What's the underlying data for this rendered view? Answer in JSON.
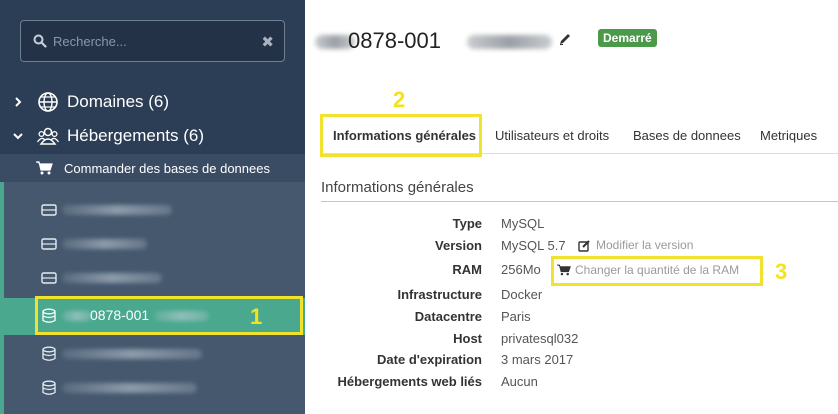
{
  "search": {
    "placeholder": "Recherche...",
    "clear_glyph": "✖"
  },
  "nav": {
    "domains": {
      "label": "Domaines (6)",
      "icon": "globe-icon"
    },
    "hosting": {
      "label": "Hébergements (6)",
      "icon": "users-icon"
    },
    "order": {
      "label": "Commander des bases de donnees",
      "icon": "cart-icon"
    }
  },
  "db_list": {
    "active_name": "0878-001"
  },
  "annotations": {
    "one": "1",
    "two": "2",
    "three": "3"
  },
  "header": {
    "title": "0878-001",
    "status": "Demarré",
    "status_color": "#4a9a4a"
  },
  "tabs": [
    {
      "label": "Informations générales"
    },
    {
      "label": "Utilisateurs et droits"
    },
    {
      "label": "Bases de donnees"
    },
    {
      "label": "Metriques"
    }
  ],
  "section": {
    "title": "Informations générales"
  },
  "info": [
    {
      "key": "Type",
      "value": "MySQL"
    },
    {
      "key": "Version",
      "value": "MySQL 5.7"
    },
    {
      "key": "RAM",
      "value": "256Mo"
    },
    {
      "key": "Infrastructure",
      "value": "Docker"
    },
    {
      "key": "Datacentre",
      "value": "Paris"
    },
    {
      "key": "Host",
      "value": "privatesql032"
    },
    {
      "key": "Date d'expiration",
      "value": "3 mars 2017"
    },
    {
      "key": "Hébergements web liés",
      "value": "Aucun"
    }
  ],
  "actions": {
    "modify_version": "Modifier la version",
    "change_ram": "Changer la quantité de la RAM"
  },
  "colors": {
    "sidebar": "#2c3e55",
    "accent": "#4aa88f",
    "highlight": "#f0e22d"
  }
}
